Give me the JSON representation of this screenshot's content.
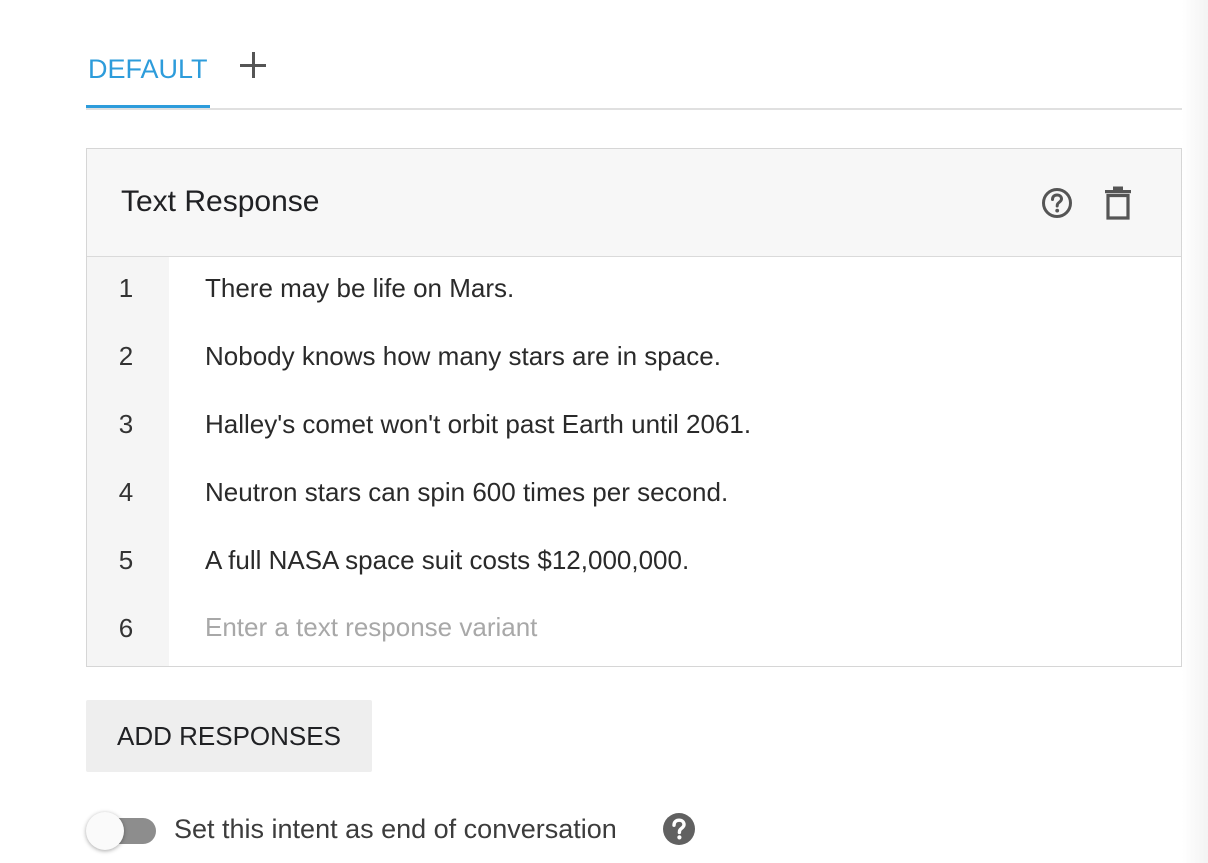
{
  "tabs": {
    "default_label": "DEFAULT",
    "add_icon": "plus-icon"
  },
  "card": {
    "title": "Text Response",
    "help_icon": "help-circle-icon",
    "delete_icon": "trash-icon",
    "rows": [
      {
        "num": "1",
        "text": "There may be life on Mars."
      },
      {
        "num": "2",
        "text": "Nobody knows how many stars are in space."
      },
      {
        "num": "3",
        "text": "Halley's comet won't orbit past Earth until 2061."
      },
      {
        "num": "4",
        "text": "Neutron stars can spin 600 times per second."
      },
      {
        "num": "5",
        "text": "A full NASA space suit costs $12,000,000."
      }
    ],
    "new_row": {
      "num": "6",
      "value": "",
      "placeholder": "Enter a text response variant"
    }
  },
  "add_responses_label": "ADD RESPONSES",
  "end_conversation": {
    "label": "Set this intent as end of conversation",
    "enabled": false,
    "help_icon": "help-filled-icon"
  },
  "colors": {
    "accent": "#2d9cdb",
    "toggle_track": "#8d8d8d"
  }
}
